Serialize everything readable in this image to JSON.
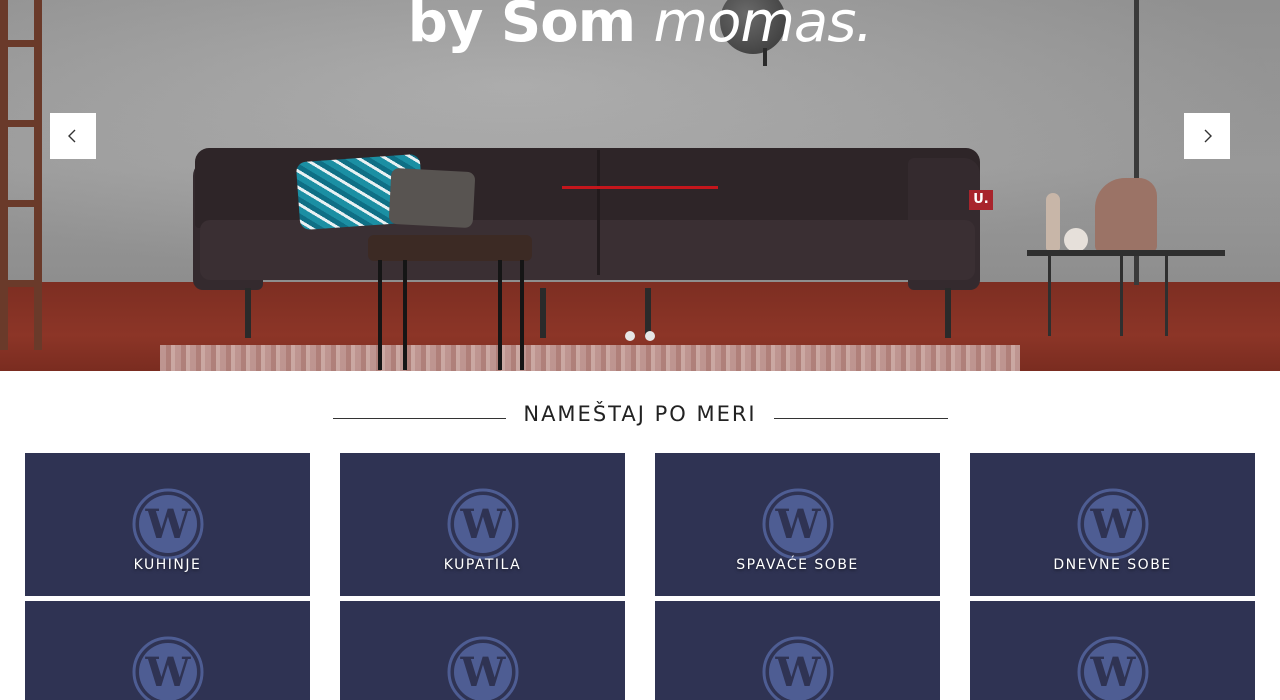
{
  "hero": {
    "title_plain": "by Som",
    "title_italic": "momas.",
    "badge_text": "U.",
    "prev_label": "previous-slide",
    "next_label": "next-slide",
    "slides_count": 2,
    "active_slide": 1
  },
  "section": {
    "title": "NAMEŠTAJ PO MERI"
  },
  "cards_row1": [
    {
      "label": "KUHINJE",
      "icon": "wordpress-icon"
    },
    {
      "label": "KUPATILA",
      "icon": "wordpress-icon"
    },
    {
      "label": "SPAVAĆE SOBE",
      "icon": "wordpress-icon"
    },
    {
      "label": "DNEVNE SOBE",
      "icon": "wordpress-icon"
    }
  ],
  "cards_row2": [
    {
      "label": "",
      "icon": "wordpress-icon"
    },
    {
      "label": "",
      "icon": "wordpress-icon"
    },
    {
      "label": "",
      "icon": "wordpress-icon"
    },
    {
      "label": "",
      "icon": "wordpress-icon"
    }
  ],
  "colors": {
    "card_bg": "#2f3353",
    "accent_red": "#c4161c",
    "wp_icon": "#4e5d93"
  }
}
